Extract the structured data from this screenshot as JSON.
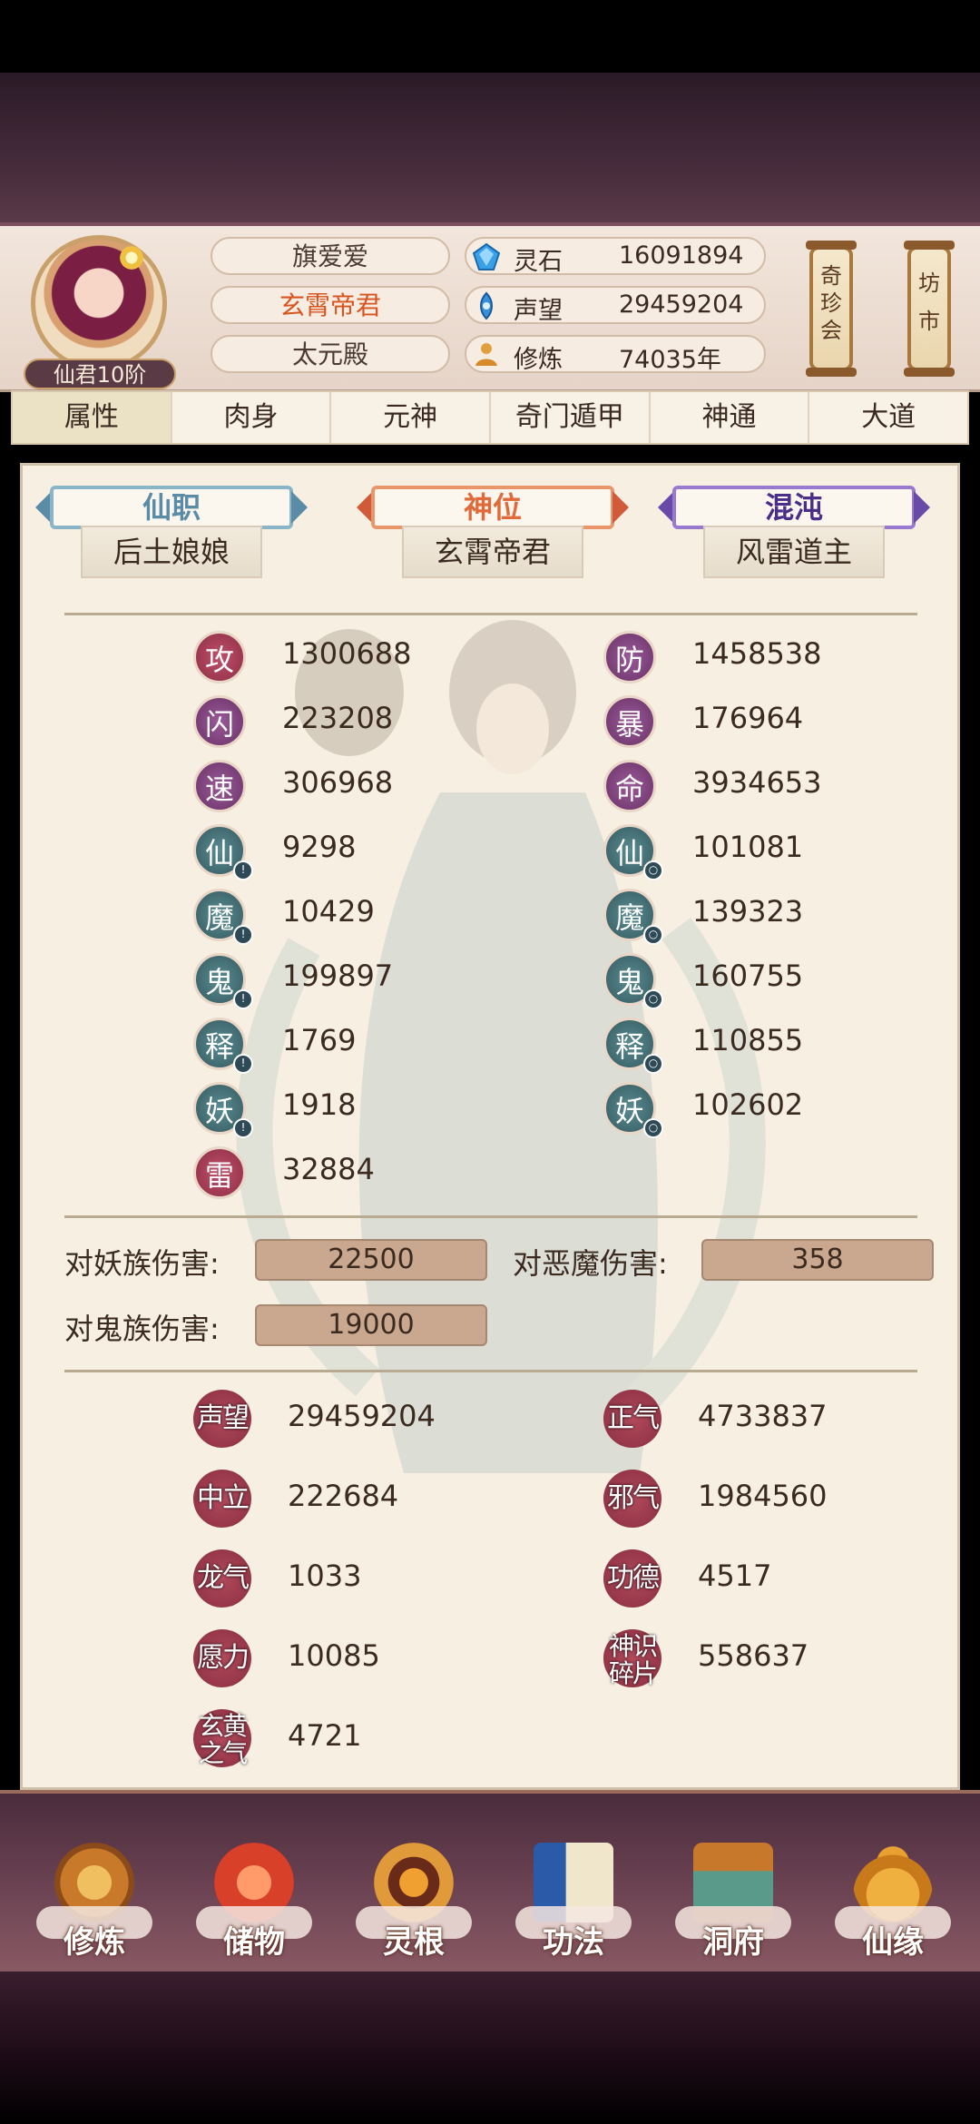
{
  "header": {
    "rank": "仙君10阶",
    "name": "旗爱爱",
    "title": "玄霄帝君",
    "palace": "太元殿",
    "resources": [
      {
        "icon": "spirit-stone-icon",
        "label": "灵石",
        "value": "16091894"
      },
      {
        "icon": "reputation-icon",
        "label": "声望",
        "value": "29459204"
      },
      {
        "icon": "cultivation-icon",
        "label": "修炼",
        "value": "74035年"
      }
    ],
    "buttons": {
      "treasure_fair": "奇珍会",
      "market": "坊市"
    }
  },
  "tabs": [
    "属性",
    "肉身",
    "元神",
    "奇门遁甲",
    "神通",
    "大道"
  ],
  "titles": [
    {
      "heading": "仙职",
      "value": "后土娘娘",
      "color": "#5a8ca8"
    },
    {
      "heading": "神位",
      "value": "玄霄帝君",
      "color": "#e06a3a"
    },
    {
      "heading": "混沌",
      "value": "风雷道主",
      "color": "#6a4aa8"
    }
  ],
  "stats_left": [
    {
      "glyph": "攻",
      "value": "1300688",
      "color": "red"
    },
    {
      "glyph": "闪",
      "value": "223208",
      "color": "purple"
    },
    {
      "glyph": "速",
      "value": "306968",
      "color": "purple"
    },
    {
      "glyph": "仙",
      "value": "9298",
      "color": "teal",
      "marker": "!"
    },
    {
      "glyph": "魔",
      "value": "10429",
      "color": "teal",
      "marker": "!"
    },
    {
      "glyph": "鬼",
      "value": "199897",
      "color": "teal",
      "marker": "!"
    },
    {
      "glyph": "释",
      "value": "1769",
      "color": "teal",
      "marker": "!"
    },
    {
      "glyph": "妖",
      "value": "1918",
      "color": "teal",
      "marker": "!"
    },
    {
      "glyph": "雷",
      "value": "32884",
      "color": "red"
    }
  ],
  "stats_right": [
    {
      "glyph": "防",
      "value": "1458538",
      "color": "purple"
    },
    {
      "glyph": "暴",
      "value": "176964",
      "color": "purple"
    },
    {
      "glyph": "命",
      "value": "3934653",
      "color": "purple"
    },
    {
      "glyph": "仙",
      "value": "101081",
      "color": "teal",
      "marker": "○"
    },
    {
      "glyph": "魔",
      "value": "139323",
      "color": "teal",
      "marker": "○"
    },
    {
      "glyph": "鬼",
      "value": "160755",
      "color": "teal",
      "marker": "○"
    },
    {
      "glyph": "释",
      "value": "110855",
      "color": "teal",
      "marker": "○"
    },
    {
      "glyph": "妖",
      "value": "102602",
      "color": "teal",
      "marker": "○"
    }
  ],
  "damage": [
    {
      "label": "对妖族伤害:",
      "value": "22500"
    },
    {
      "label": "对恶魔伤害:",
      "value": "358"
    },
    {
      "label": "对鬼族伤害:",
      "value": "19000"
    }
  ],
  "misc_left": [
    {
      "label": "声望",
      "value": "29459204"
    },
    {
      "label": "中立",
      "value": "222684"
    },
    {
      "label": "龙气",
      "value": "1033"
    },
    {
      "label": "愿力",
      "value": "10085"
    },
    {
      "label": "玄黄\n之气",
      "value": "4721"
    }
  ],
  "misc_right": [
    {
      "label": "正气",
      "value": "4733837"
    },
    {
      "label": "邪气",
      "value": "1984560"
    },
    {
      "label": "功德",
      "value": "4517"
    },
    {
      "label": "神识\n碎片",
      "value": "558637"
    }
  ],
  "bottom_nav": [
    {
      "label": "修炼",
      "icon": "cultivate-icon"
    },
    {
      "label": "储物",
      "icon": "storage-bag-icon"
    },
    {
      "label": "灵根",
      "icon": "spirit-root-icon"
    },
    {
      "label": "功法",
      "icon": "skill-book-icon"
    },
    {
      "label": "洞府",
      "icon": "cave-dwelling-icon"
    },
    {
      "label": "仙缘",
      "icon": "gourd-icon"
    }
  ]
}
